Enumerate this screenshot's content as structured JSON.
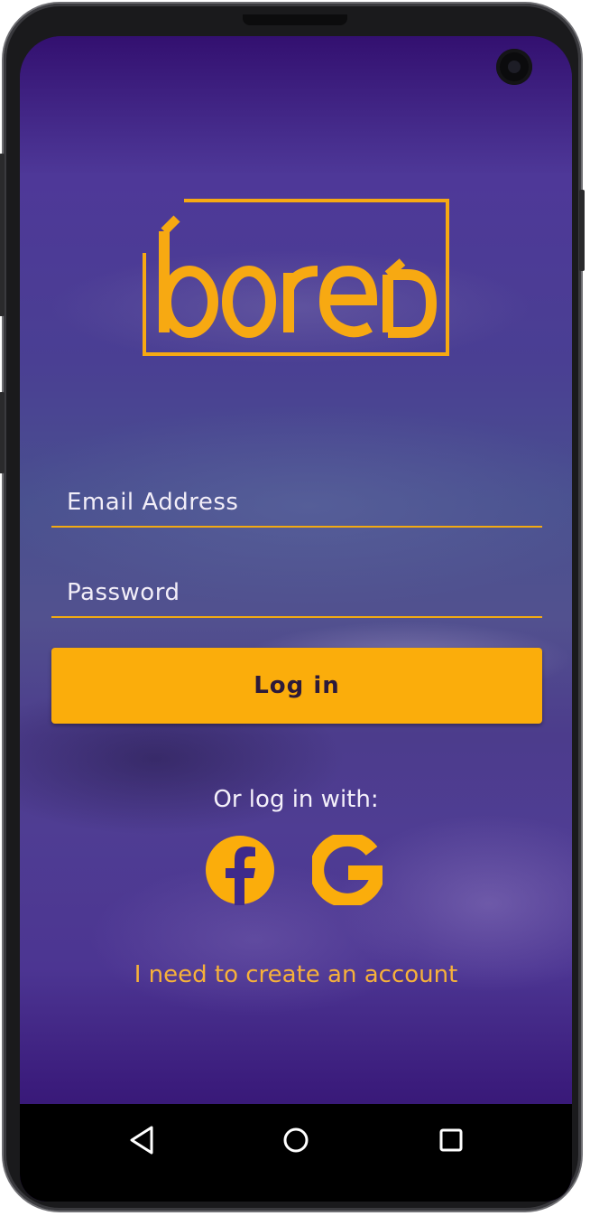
{
  "app": {
    "logo_text": "bored",
    "accent_color": "#fbad0b",
    "background_color": "#3f2a8a"
  },
  "form": {
    "email_label": "Email Address",
    "password_label": "Password",
    "login_label": "Log in"
  },
  "social": {
    "prompt": "Or log in with:",
    "providers": [
      {
        "name": "facebook",
        "icon": "facebook-icon"
      },
      {
        "name": "google",
        "icon": "google-icon"
      }
    ]
  },
  "signup": {
    "link_label": "I need to create an account"
  },
  "system_nav": {
    "buttons": [
      {
        "name": "back",
        "icon": "triangle-back-icon"
      },
      {
        "name": "home",
        "icon": "circle-home-icon"
      },
      {
        "name": "recents",
        "icon": "square-recents-icon"
      }
    ]
  }
}
